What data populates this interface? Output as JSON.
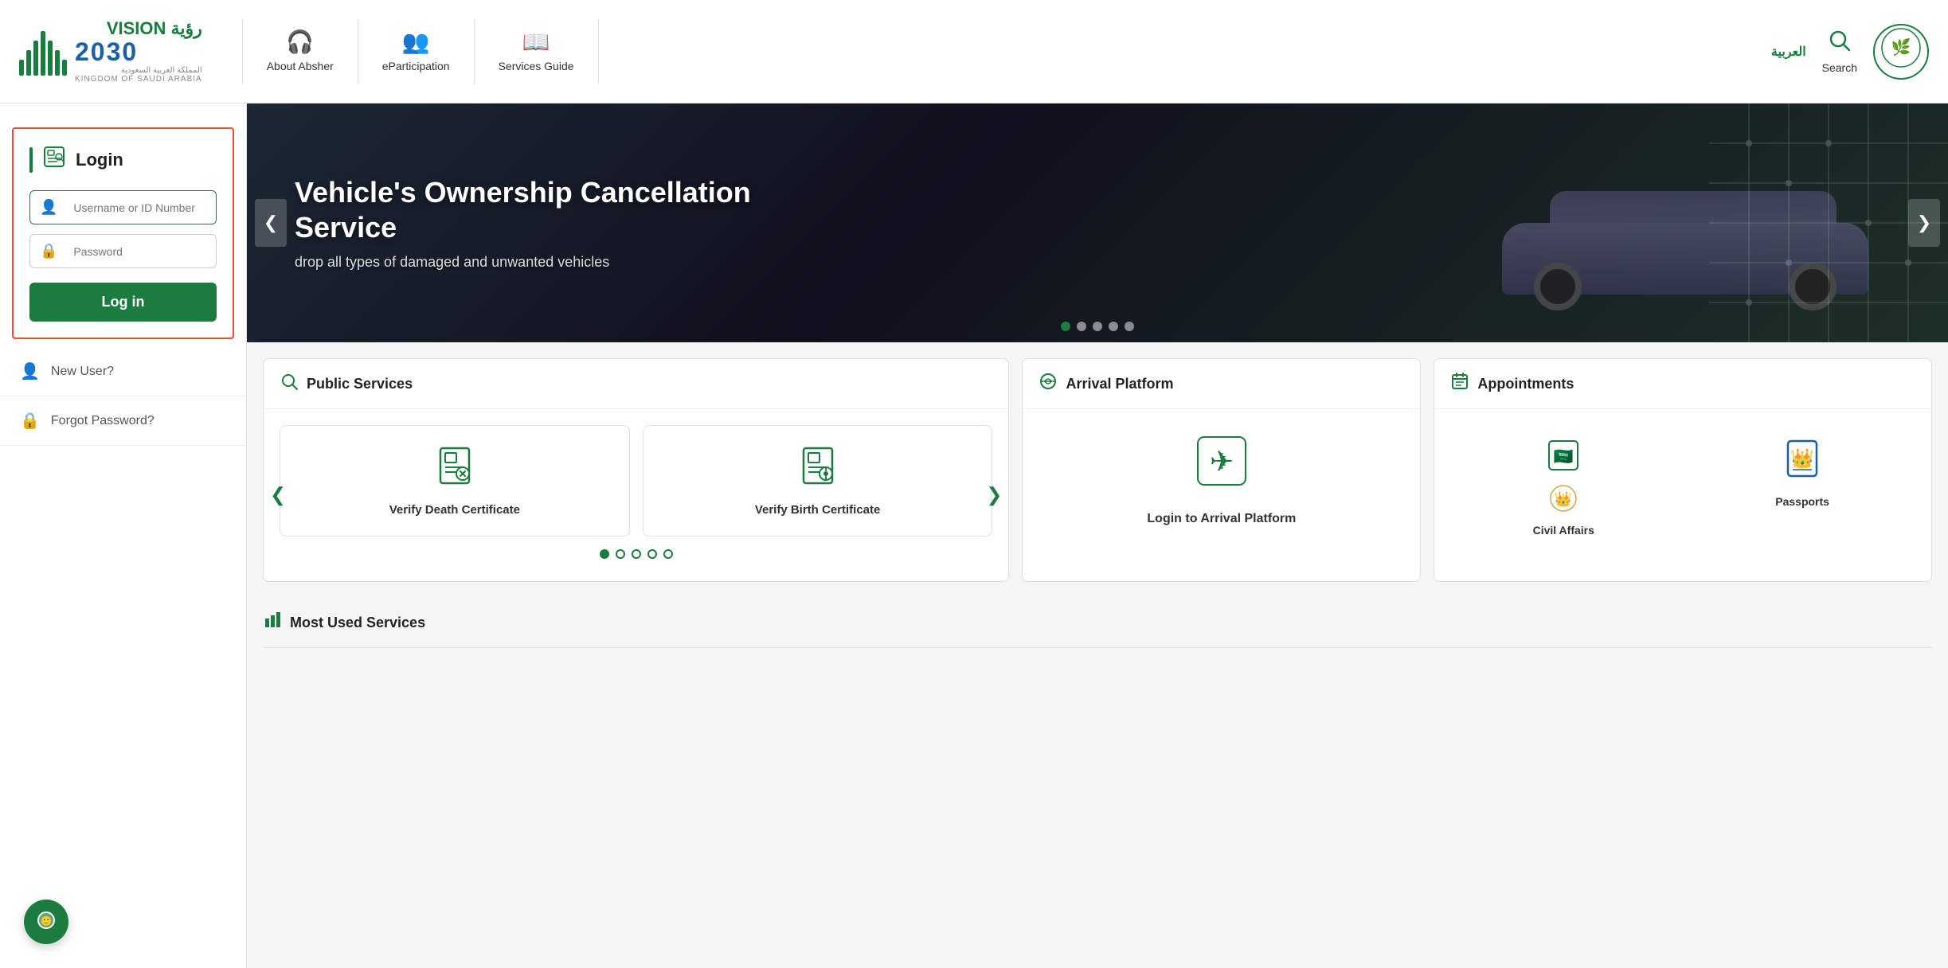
{
  "header": {
    "nav_items": [
      {
        "key": "about",
        "label": "About Absher",
        "icon": "headset"
      },
      {
        "key": "eparticipation",
        "label": "eParticipation",
        "icon": "people"
      },
      {
        "key": "services_guide",
        "label": "Services Guide",
        "icon": "book"
      }
    ],
    "arabic_label": "العربية",
    "search_label": "Search",
    "vision_title": "رؤية VISION",
    "vision_year": "2030",
    "vision_sub": "المملكة العربية السعودية",
    "vision_kingdom": "KINGDOM OF SAUDI ARABIA"
  },
  "login": {
    "title": "Login",
    "username_placeholder": "Username or ID Number",
    "password_placeholder": "Password",
    "login_button": "Log in",
    "new_user_label": "New User?",
    "forgot_password_label": "Forgot Password?"
  },
  "hero": {
    "title": "Vehicle's Ownership Cancellation Service",
    "subtitle": "drop all types of damaged and unwanted vehicles",
    "dots_count": 5,
    "active_dot": 0
  },
  "public_services": {
    "section_title": "Public Services",
    "items": [
      {
        "label": "Verify Death Certificate",
        "icon": "death-cert"
      },
      {
        "label": "Verify Birth Certificate",
        "icon": "birth-cert"
      }
    ],
    "dots_count": 5,
    "active_dot": 0
  },
  "arrival_platform": {
    "section_title": "Arrival Platform",
    "login_label": "Login to Arrival Platform"
  },
  "appointments": {
    "section_title": "Appointments",
    "items": [
      {
        "label": "Civil Affairs",
        "icon": "civil"
      },
      {
        "label": "Passports",
        "icon": "passport"
      }
    ]
  },
  "most_used": {
    "section_title": "Most Used Services"
  }
}
